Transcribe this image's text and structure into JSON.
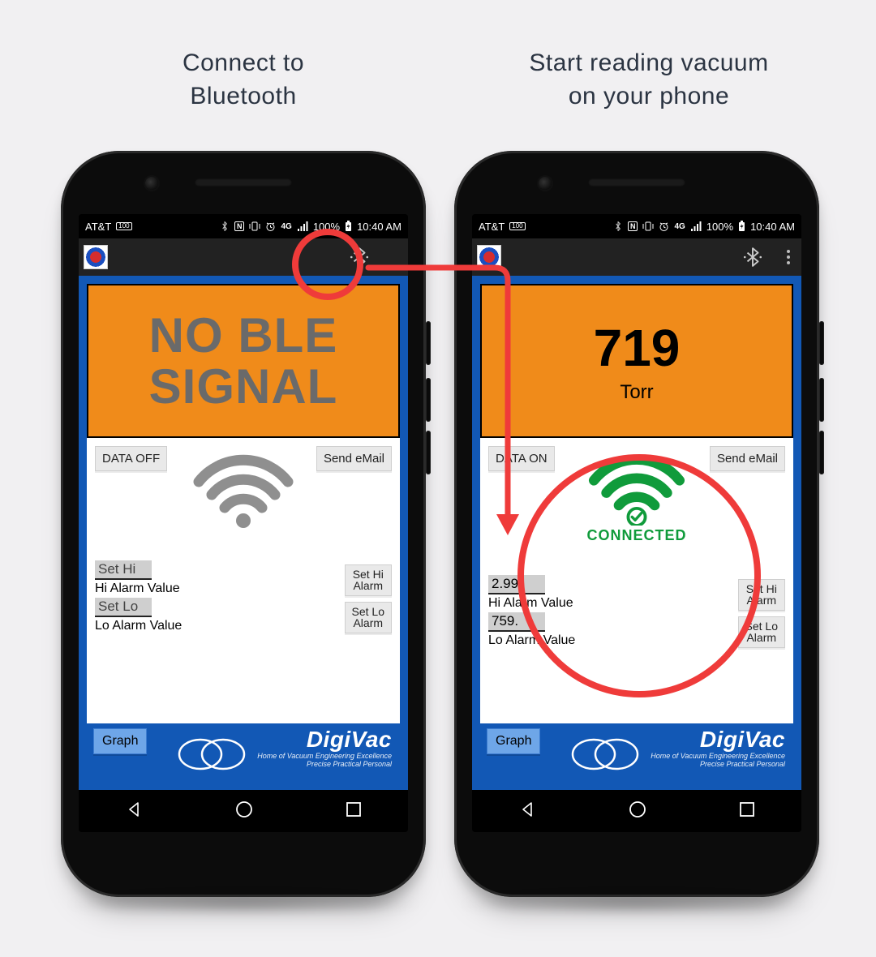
{
  "captions": {
    "left": "Connect to\nBluetooth",
    "right": "Start reading vacuum\non your phone"
  },
  "statusbar": {
    "carrier": "AT&T",
    "battery_box": "100",
    "battery_pct": "100%",
    "time": "10:40 AM",
    "net_label": "4G"
  },
  "brand": {
    "name": "DigiVac",
    "tagline1": "Home of Vacuum Engineering Excellence",
    "tagline2": "Precise Practical Personal"
  },
  "common": {
    "send_email": "Send eMail",
    "set_hi_btn": "Set Hi\nAlarm",
    "set_lo_btn": "Set Lo\nAlarm",
    "graph": "Graph",
    "hi_placeholder": "Set Hi",
    "hi_label": "Hi Alarm Value",
    "lo_placeholder": "Set Lo",
    "lo_label": "Lo Alarm Value"
  },
  "left_phone": {
    "readout_text": "NO BLE\nSIGNAL",
    "data_btn": "DATA OFF",
    "connected": false,
    "hi_value": "",
    "lo_value": ""
  },
  "right_phone": {
    "readout_value": "719",
    "readout_unit": "Torr",
    "data_btn": "DATA ON",
    "connected_label": "CONNECTED",
    "connected": true,
    "hi_value": "2.99",
    "lo_value": "759."
  },
  "annotation": {
    "arrow_color": "#ef3b3a"
  }
}
